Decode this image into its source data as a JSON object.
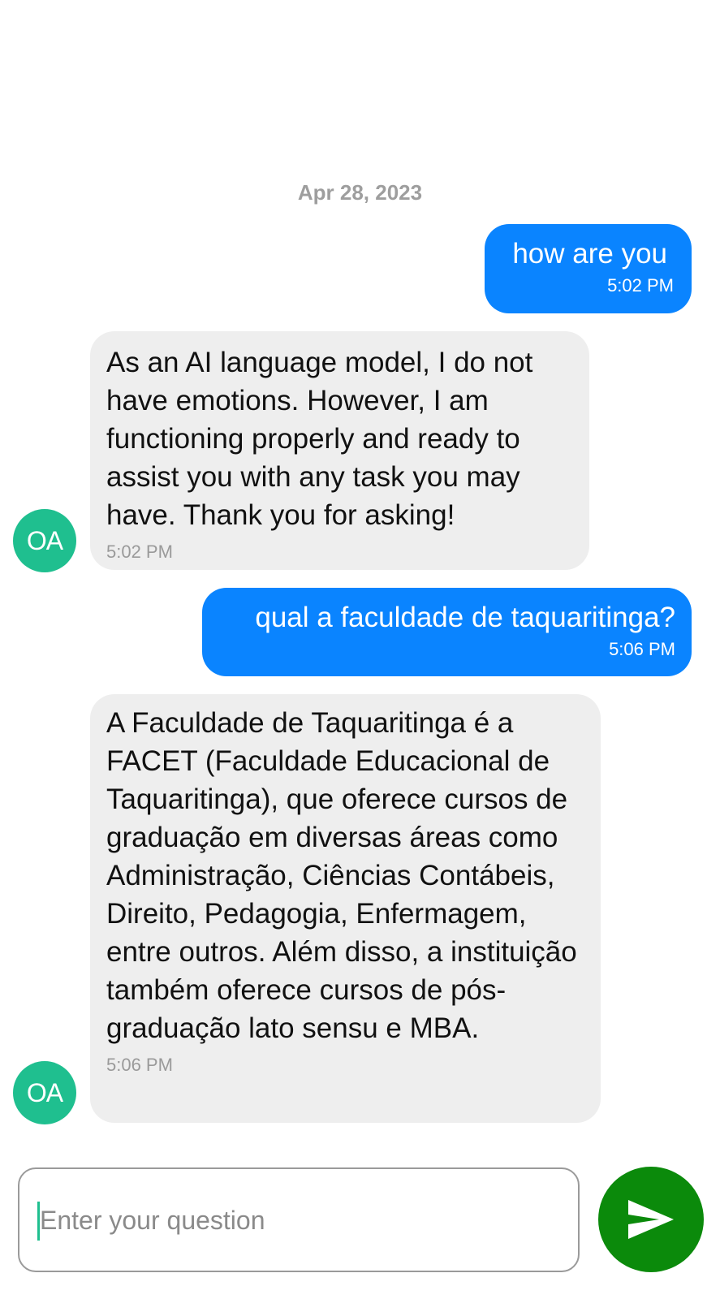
{
  "chat": {
    "date": "Apr 28, 2023",
    "messages": [
      {
        "role": "user",
        "text": "how are you",
        "time": "5:02 PM"
      },
      {
        "role": "assistant",
        "avatar": "OA",
        "text": "As an AI language model, I do not have emotions. However, I am functioning properly and ready to assist you with any task you may have. Thank you for asking!",
        "time": "5:02 PM"
      },
      {
        "role": "user",
        "text": "qual a faculdade de taquaritinga?",
        "time": "5:06 PM"
      },
      {
        "role": "assistant",
        "avatar": "OA",
        "text": "A Faculdade de Taquaritinga é a FACET (Faculdade Educacional de Taquaritinga), que oferece cursos de graduação em diversas áreas como Administração, Ciências Contábeis, Direito, Pedagogia, Enfermagem, entre outros. Além disso, a instituição também oferece cursos de pós-graduação lato sensu e MBA.",
        "time": "5:06 PM"
      }
    ]
  },
  "composer": {
    "placeholder": "Enter your question",
    "value": "",
    "send_icon": "send-icon"
  },
  "colors": {
    "user_bubble": "#0a84ff",
    "assistant_bubble": "#eeeeee",
    "avatar": "#1fbf8f",
    "send_button": "#0b8a0b"
  }
}
